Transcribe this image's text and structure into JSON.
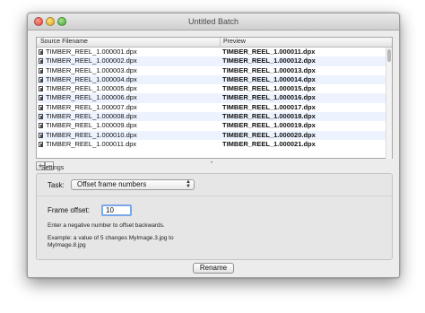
{
  "window": {
    "title": "Untitled Batch"
  },
  "table": {
    "columns": {
      "source": "Source Filename",
      "preview": "Preview"
    },
    "rows": [
      {
        "source": "TIMBER_REEL_1.000001.dpx",
        "preview": "TIMBER_REEL_1.000011.dpx"
      },
      {
        "source": "TIMBER_REEL_1.000002.dpx",
        "preview": "TIMBER_REEL_1.000012.dpx"
      },
      {
        "source": "TIMBER_REEL_1.000003.dpx",
        "preview": "TIMBER_REEL_1.000013.dpx"
      },
      {
        "source": "TIMBER_REEL_1.000004.dpx",
        "preview": "TIMBER_REEL_1.000014.dpx"
      },
      {
        "source": "TIMBER_REEL_1.000005.dpx",
        "preview": "TIMBER_REEL_1.000015.dpx"
      },
      {
        "source": "TIMBER_REEL_1.000006.dpx",
        "preview": "TIMBER_REEL_1.000016.dpx"
      },
      {
        "source": "TIMBER_REEL_1.000007.dpx",
        "preview": "TIMBER_REEL_1.000017.dpx"
      },
      {
        "source": "TIMBER_REEL_1.000008.dpx",
        "preview": "TIMBER_REEL_1.000018.dpx"
      },
      {
        "source": "TIMBER_REEL_1.000009.dpx",
        "preview": "TIMBER_REEL_1.000019.dpx"
      },
      {
        "source": "TIMBER_REEL_1.000010.dpx",
        "preview": "TIMBER_REEL_1.000020.dpx"
      },
      {
        "source": "TIMBER_REEL_1.000011.dpx",
        "preview": "TIMBER_REEL_1.000021.dpx"
      }
    ]
  },
  "list_controls": {
    "add_label": "+",
    "remove_label": "−"
  },
  "settings": {
    "label": "Settings",
    "task_label": "Task:",
    "task_value": "Offset frame numbers",
    "offset_label": "Frame offset:",
    "offset_value": "10",
    "help_text": "Enter a negative number to offset backwards.",
    "example_text": "Example: a value of 5 changes MyImage.3.jpg to MyImage.8.jpg"
  },
  "actions": {
    "rename_label": "Rename"
  }
}
